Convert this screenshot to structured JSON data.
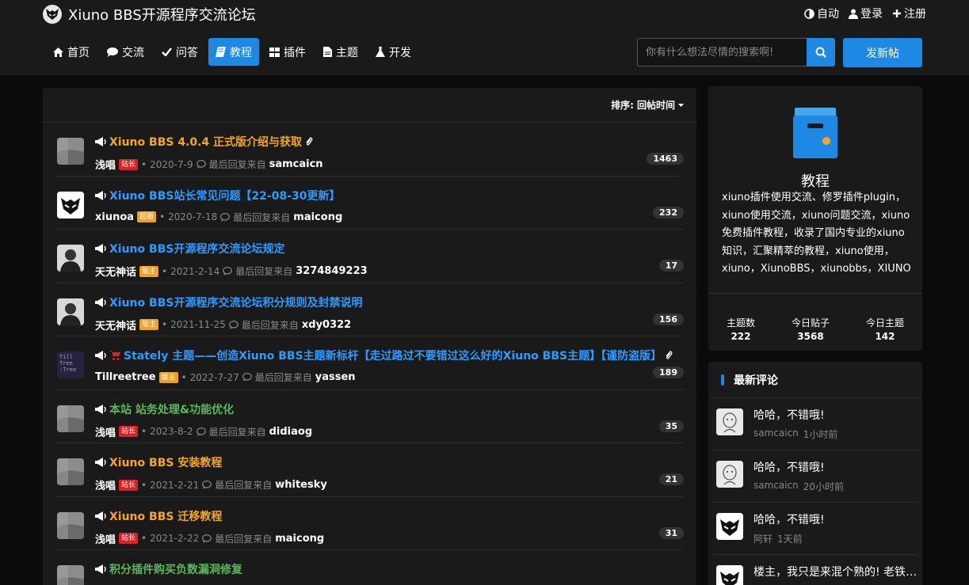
{
  "site": {
    "title": "Xiuno BBS开源程序交流论坛"
  },
  "top_links": {
    "auto": "自动",
    "login": "登录",
    "register": "注册"
  },
  "nav": [
    {
      "label": "首页",
      "icon": "home-icon"
    },
    {
      "label": "交流",
      "icon": "comment-icon"
    },
    {
      "label": "问答",
      "icon": "check-icon"
    },
    {
      "label": "教程",
      "icon": "book-icon",
      "active": true
    },
    {
      "label": "插件",
      "icon": "grid-icon"
    },
    {
      "label": "主题",
      "icon": "file-icon"
    },
    {
      "label": "开发",
      "icon": "flask-icon"
    }
  ],
  "search": {
    "placeholder": "你有什么想法尽情的搜索啊!"
  },
  "post_button": "发新帖",
  "sort": {
    "label": "排序:",
    "value": "回帖时间"
  },
  "threads": [
    {
      "title": "Xiuno BBS 4.0.4 正式版介绍与获取",
      "color": "#f5a623",
      "attach": true,
      "author": "浅唱",
      "badge": "站长",
      "badge_color": "red",
      "date": "2020-7-9",
      "last_label": "最后回复来自",
      "last_user": "samcaicn",
      "count": "1463",
      "avatar_color": "#9a9a9a"
    },
    {
      "title": "Xiuno BBS站长常见问题【22-08-30更新】",
      "color": "#2f9bff",
      "author": "xiunoa",
      "badge": "超版",
      "badge_color": "orange",
      "date": "2020-7-18",
      "last_label": "最后回复来自",
      "last_user": "maicong",
      "count": "232",
      "avatar_color": "#ffffff"
    },
    {
      "title": "Xiuno BBS开源程序交流论坛规定",
      "color": "#2f9bff",
      "author": "天无神话",
      "badge": "版主",
      "badge_color": "orange",
      "date": "2021-2-14",
      "last_label": "最后回复来自",
      "last_user": "3274849223",
      "count": "17",
      "avatar_color": "#cccccc"
    },
    {
      "title": "Xiuno BBS开源程序交流论坛积分规则及封禁说明",
      "color": "#2f9bff",
      "author": "天无神话",
      "badge": "版主",
      "badge_color": "orange",
      "date": "2021-11-25",
      "last_label": "最后回复来自",
      "last_user": "xdy0322",
      "count": "156",
      "avatar_color": "#cccccc"
    },
    {
      "title": "Stately 主题——创造Xiuno BBS主题新标杆【走过路过不要错过这么好的Xiuno BBS主题】【谨防盗版】",
      "color": "#2f9bff",
      "cart": true,
      "attach": true,
      "author": "Tillreetree",
      "badge": "版主",
      "badge_color": "orange",
      "date": "2022-7-27",
      "last_label": "最后回复来自",
      "last_user": "yassen",
      "count": "189",
      "avatar_color": "#2a2140",
      "avatar_text": "Till Tree :Tree"
    },
    {
      "title": "本站 站务处理&功能优化",
      "color": "#5cb85c",
      "author": "浅唱",
      "badge": "站长",
      "badge_color": "red",
      "date": "2023-8-2",
      "last_label": "最后回复来自",
      "last_user": "didiaog",
      "count": "35",
      "avatar_color": "#9a9a9a"
    },
    {
      "title": "Xiuno BBS 安装教程",
      "color": "#f5a623",
      "author": "浅唱",
      "badge": "站长",
      "badge_color": "red",
      "date": "2021-2-21",
      "last_label": "最后回复来自",
      "last_user": "whitesky",
      "count": "21",
      "avatar_color": "#9a9a9a"
    },
    {
      "title": "Xiuno BBS 迁移教程",
      "color": "#f5a623",
      "author": "浅唱",
      "badge": "站长",
      "badge_color": "red",
      "date": "2021-2-22",
      "last_label": "最后回复来自",
      "last_user": "maicong",
      "count": "31",
      "avatar_color": "#9a9a9a"
    },
    {
      "title": "积分插件购买负数漏洞修复",
      "color": "#5cb85c",
      "author": "",
      "badge": "",
      "date": "",
      "last_label": "",
      "last_user": "",
      "count": "",
      "avatar_color": "#9a9a9a"
    }
  ],
  "forum": {
    "name": "教程",
    "description": "xiuno插件使用交流、修罗插件plugin，xiuno使用交流，xiuno问题交流，xiuno免费插件教程，收录了国内专业的xiuno知识，汇聚精萃的教程，xiuno使用，xiuno，XiunoBBS，xiunobbs，XIUNO",
    "stats": [
      {
        "label": "主题数",
        "value": "222"
      },
      {
        "label": "今日贴子",
        "value": "3568"
      },
      {
        "label": "今日主题",
        "value": "142"
      }
    ]
  },
  "comments": {
    "title": "最新评论",
    "items": [
      {
        "text": "哈哈，不错哦!",
        "user": "samcaicn",
        "time": "1小时前",
        "avatar": "sketch"
      },
      {
        "text": "哈哈，不错哦!",
        "user": "samcaicn",
        "time": "20小时前",
        "avatar": "sketch"
      },
      {
        "text": "哈哈，不错哦!",
        "user": "阿轩",
        "time": "1天前",
        "avatar": "logo"
      },
      {
        "text": "楼主，我只是来混个熟的!  老铁们好",
        "user": "",
        "time": "",
        "avatar": "logo"
      }
    ]
  }
}
